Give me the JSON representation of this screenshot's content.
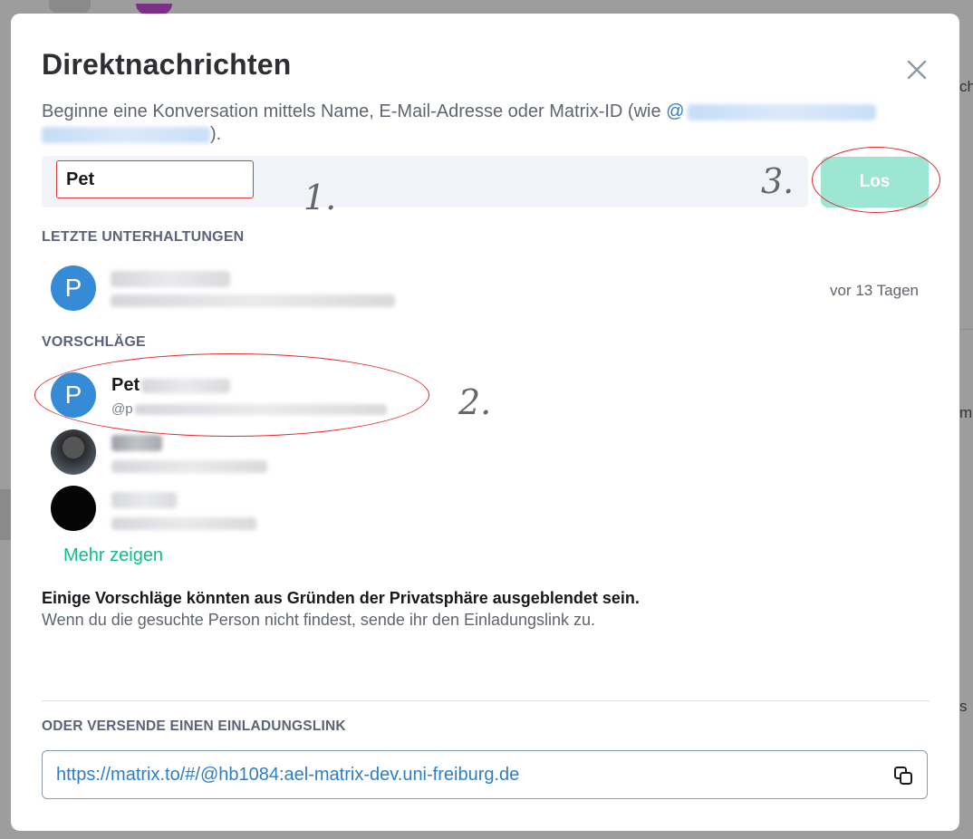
{
  "background": {
    "fragment_1": "ch",
    "fragment_2": "m",
    "fragment_3": "s"
  },
  "dialog": {
    "title": "Direktnachrichten",
    "description_prefix": "Beginne eine Konversation mittels Name, E-Mail-Adresse oder Matrix-ID (wie ",
    "description_example_start": "@",
    "description_suffix": ")."
  },
  "search": {
    "value": "Pet",
    "go_label": "Los"
  },
  "annotations": {
    "step1": "1.",
    "step2": "2.",
    "step3": "3."
  },
  "recent": {
    "section_label": "LETZTE UNTERHALTUNGEN",
    "items": [
      {
        "avatar_letter": "P",
        "timestamp": "vor 13 Tagen"
      }
    ]
  },
  "suggestions": {
    "section_label": "VORSCHLÄGE",
    "items": [
      {
        "avatar_letter": "P",
        "name_visible": "Pet",
        "id_visible": "@p"
      }
    ],
    "more_label": "Mehr zeigen"
  },
  "privacy": {
    "title": "Einige Vorschläge könnten aus Gründen der Privatsphäre ausgeblendet sein.",
    "text": "Wenn du die gesuchte Person nicht findest, sende ihr den Einladungslink zu."
  },
  "invite": {
    "section_label": "ODER VERSENDE EINEN EINLADUNGSLINK",
    "link": "https://matrix.to/#/@hb1084:ael-matrix-dev.uni-freiburg.de"
  },
  "icons": {
    "close": "close-icon",
    "copy": "copy-icon"
  },
  "colors": {
    "accent_green": "#0dbd8b",
    "button_disabled": "#9de6d3",
    "link_blue": "#2f7ec2",
    "avatar_blue": "#368bd6",
    "annotation_red": "#e02a2a"
  }
}
